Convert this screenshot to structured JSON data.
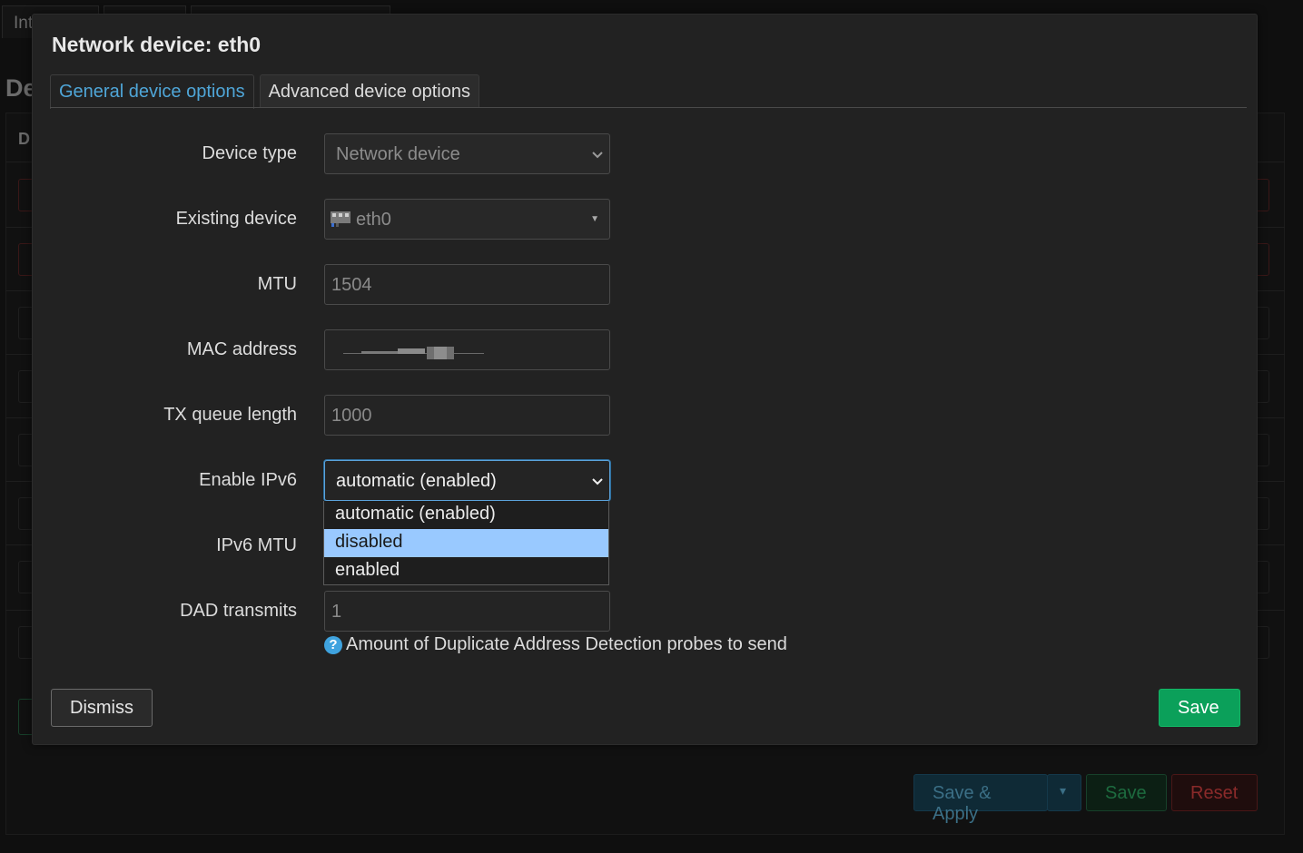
{
  "background": {
    "tabs": [
      "Int",
      "",
      ""
    ],
    "section_title": "De",
    "column_header": "D",
    "buttons": {
      "save_apply": "Save & Apply",
      "save_apply_arrow": "▾",
      "save": "Save",
      "reset": "Reset"
    }
  },
  "modal": {
    "title": "Network device: eth0",
    "tabs": [
      {
        "label": "General device options",
        "active": true
      },
      {
        "label": "Advanced device options",
        "active": false
      }
    ],
    "fields": {
      "device_type": {
        "label": "Device type",
        "value": "Network device"
      },
      "existing_device": {
        "label": "Existing device",
        "value": "eth0"
      },
      "mtu": {
        "label": "MTU",
        "placeholder": "1504"
      },
      "mac_address": {
        "label": "MAC address",
        "value": ""
      },
      "tx_queue_length": {
        "label": "TX queue length",
        "placeholder": "1000"
      },
      "enable_ipv6": {
        "label": "Enable IPv6",
        "value": "automatic (enabled)"
      },
      "ipv6_mtu": {
        "label": "IPv6 MTU"
      },
      "dad_transmits": {
        "label": "DAD transmits",
        "placeholder": "1"
      }
    },
    "ipv6_options": [
      "automatic (enabled)",
      "disabled",
      "enabled"
    ],
    "highlighted_option_index": 1,
    "help_text": "Amount of Duplicate Address Detection probes to send",
    "help_icon": "?",
    "buttons": {
      "dismiss": "Dismiss",
      "save": "Save"
    },
    "colors": {
      "active_tab": "#4fa6d8",
      "save_button": "#0ba05a",
      "highlight": "#99c9ff",
      "help_icon": "#3fa3df"
    }
  }
}
